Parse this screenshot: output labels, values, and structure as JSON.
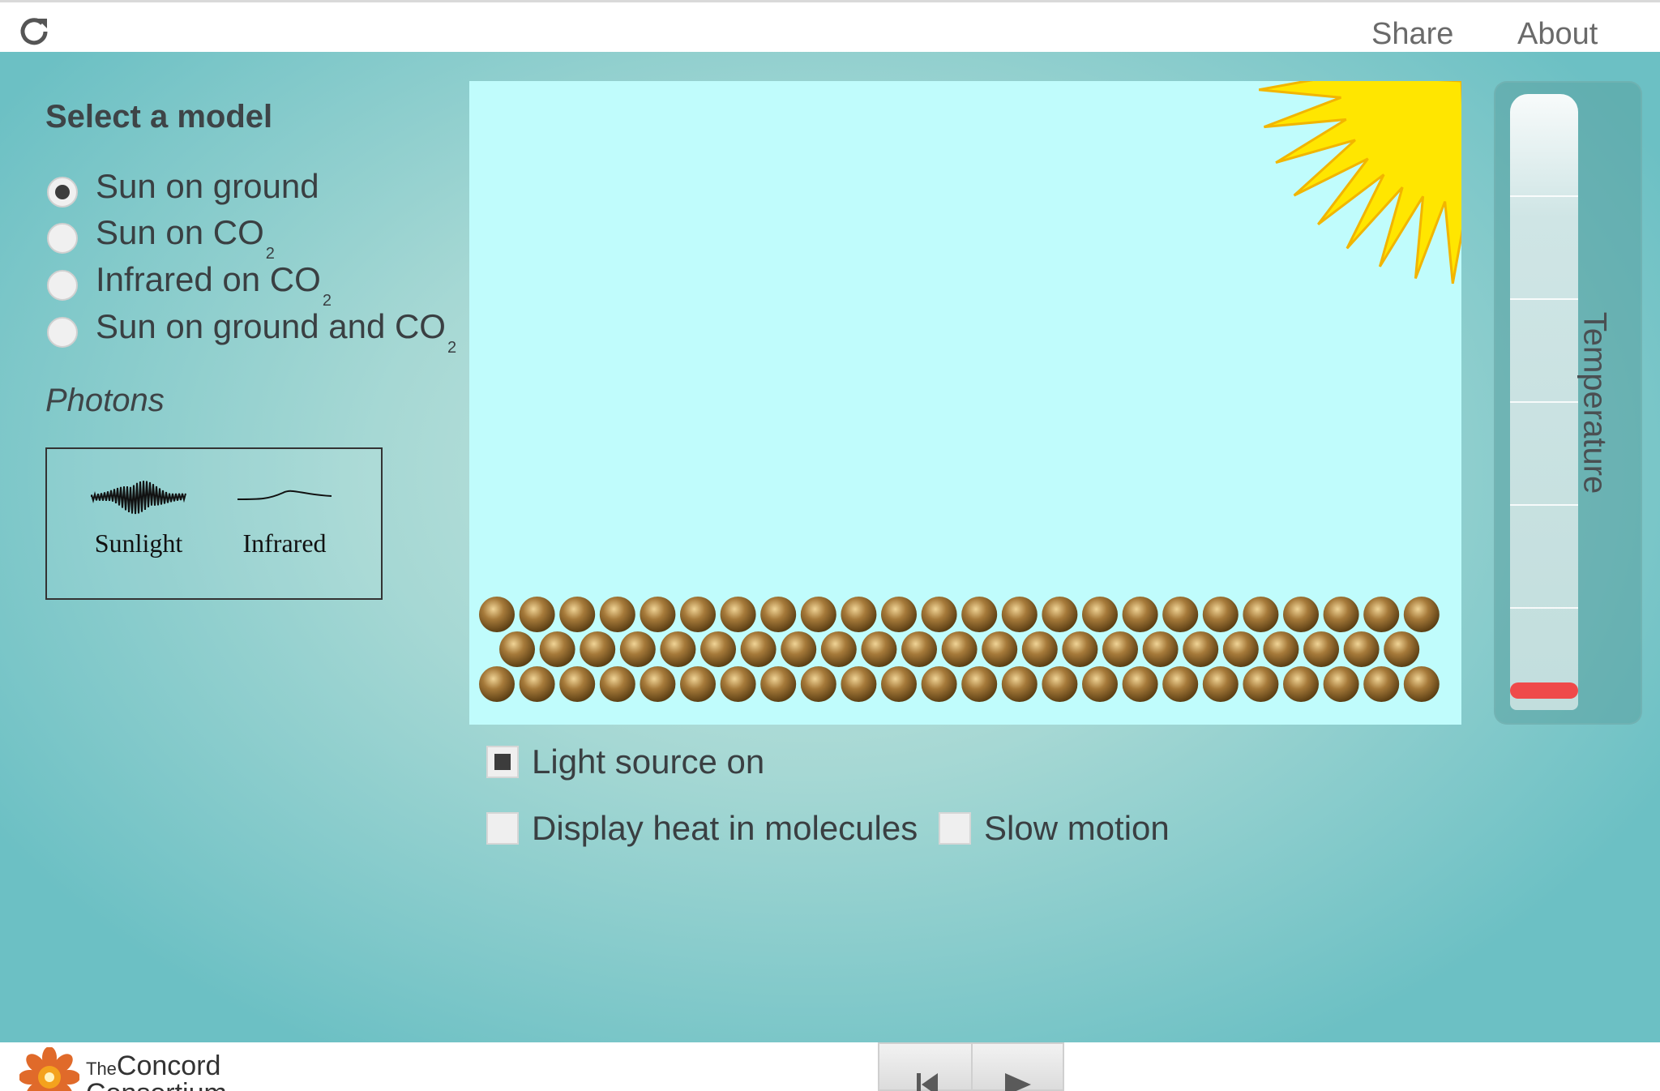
{
  "topbar": {
    "reload_icon": "reload-icon",
    "share": "Share",
    "about": "About"
  },
  "sidebar": {
    "title": "Select a model",
    "models": [
      {
        "label": "Sun on ground",
        "sub": "",
        "checked": true
      },
      {
        "label": "Sun on CO",
        "sub": "2",
        "checked": false
      },
      {
        "label": "Infrared on CO",
        "sub": "2",
        "checked": false
      },
      {
        "label": "Sun on ground and CO",
        "sub": "2",
        "checked": false
      }
    ],
    "photons_heading": "Photons",
    "legend": {
      "sunlight": "Sunlight",
      "infrared": "Infrared"
    }
  },
  "simulation": {
    "sun_icon": "sun-icon",
    "sky_color": "#c0fcfc",
    "sun_color": "#ffe600",
    "molecule_color": "#8a6a2e"
  },
  "options": {
    "light_source": {
      "label": "Light source on",
      "checked": true
    },
    "display_heat": {
      "label": "Display heat in molecules",
      "checked": false
    },
    "slow_motion": {
      "label": "Slow motion",
      "checked": false
    }
  },
  "thermometer": {
    "label": "Temperature",
    "level": 0.02,
    "fill_color": "#ef4a4a"
  },
  "footer": {
    "logo_line1_small": "The",
    "logo_line1": "Concord",
    "logo_line2": "Consortium",
    "controls": [
      "reset-icon",
      "play-icon"
    ]
  }
}
